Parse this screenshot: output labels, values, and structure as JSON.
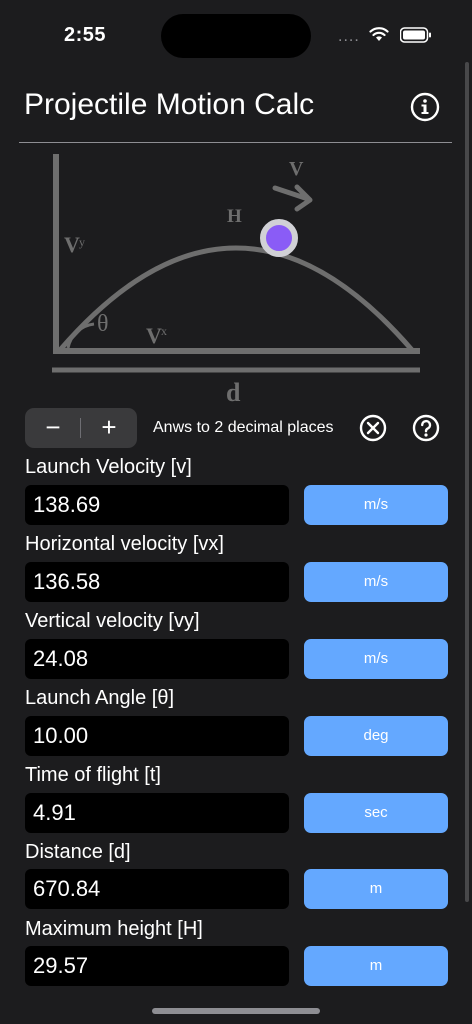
{
  "status_bar": {
    "time": "2:55",
    "signal": "...."
  },
  "nav": {
    "title": "Projectile Motion Calc"
  },
  "diagram": {
    "labels": {
      "vy": "V",
      "vy_sub": "y",
      "vx": "V",
      "vx_sub": "x",
      "theta": "θ",
      "h": "H",
      "v": "V",
      "d": "d"
    },
    "colors": {
      "line": "#6e6e6e",
      "ball": "#8a5cf6",
      "ball_ring": "#d1d1d6"
    }
  },
  "controls": {
    "minus": "−",
    "plus": "+",
    "precision_text": "Anws to 2 decimal places"
  },
  "fields": [
    {
      "label": "Launch Velocity [v]",
      "value": "138.69",
      "unit": "m/s"
    },
    {
      "label": "Horizontal velocity [vx]",
      "value": "136.58",
      "unit": "m/s"
    },
    {
      "label": "Vertical velocity [vy]",
      "value": "24.08",
      "unit": "m/s"
    },
    {
      "label": "Launch Angle [θ]",
      "value": "10.00",
      "unit": "deg"
    },
    {
      "label": "Time of flight [t]",
      "value": "4.91",
      "unit": "sec"
    },
    {
      "label": "Distance [d]",
      "value": "670.84",
      "unit": "m"
    },
    {
      "label": "Maximum height [H]",
      "value": "29.57",
      "unit": "m"
    }
  ],
  "colors": {
    "accent": "#64a8ff",
    "background": "#1c1c1e",
    "field_bg": "#000000"
  }
}
